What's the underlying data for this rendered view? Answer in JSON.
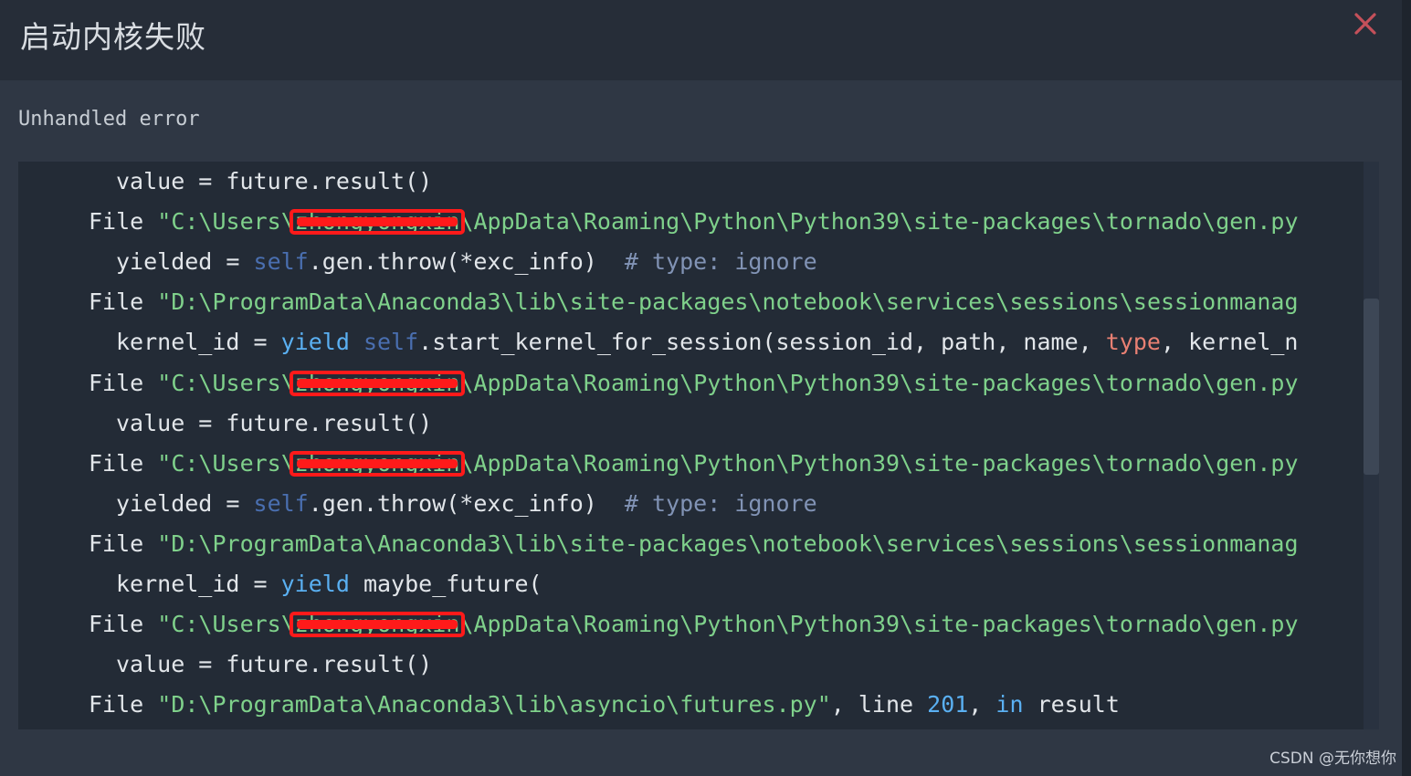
{
  "dialog": {
    "title": "启动内核失败",
    "close_icon": "close-icon",
    "error_label": "Unhandled error"
  },
  "colors": {
    "header_bg": "#262d38",
    "body_bg": "#2f3744",
    "trace_bg": "#232b36",
    "string": "#7fd18b",
    "keyword": "#5ab0f2",
    "self": "#4a6fb0",
    "builtin_type": "#e98073",
    "comment": "#8193b5",
    "redaction": "#ff1a1a",
    "close": "#c4505a"
  },
  "traceback": [
    {
      "tokens": [
        {
          "t": "value = future.result()"
        }
      ]
    },
    {
      "tokens": [
        {
          "t": "File "
        },
        {
          "t": "\"C:\\Users\\",
          "c": "str"
        },
        {
          "t": "zhongyongxin",
          "c": "str",
          "redacted": true
        },
        {
          "t": "\\AppData\\Roaming\\Python\\Python39\\site-packages\\tornado\\gen.py",
          "c": "str"
        }
      ]
    },
    {
      "tokens": [
        {
          "t": "yielded = "
        },
        {
          "t": "self",
          "c": "self"
        },
        {
          "t": ".gen.throw(*exc_info)  "
        },
        {
          "t": "# type: ignore",
          "c": "comment"
        }
      ]
    },
    {
      "tokens": [
        {
          "t": "File "
        },
        {
          "t": "\"D:\\ProgramData\\Anaconda3\\lib\\site-packages\\notebook\\services\\sessions\\sessionmanag",
          "c": "str"
        }
      ]
    },
    {
      "tokens": [
        {
          "t": "kernel_id = "
        },
        {
          "t": "yield",
          "c": "kw"
        },
        {
          "t": " "
        },
        {
          "t": "self",
          "c": "self"
        },
        {
          "t": ".start_kernel_for_session(session_id, path, name, "
        },
        {
          "t": "type",
          "c": "type"
        },
        {
          "t": ", kernel_n"
        }
      ]
    },
    {
      "tokens": [
        {
          "t": "File "
        },
        {
          "t": "\"C:\\Users\\",
          "c": "str"
        },
        {
          "t": "zhongyongxin",
          "c": "str",
          "redacted": true
        },
        {
          "t": "\\AppData\\Roaming\\Python\\Python39\\site-packages\\tornado\\gen.py",
          "c": "str"
        }
      ]
    },
    {
      "tokens": [
        {
          "t": "value = future.result()"
        }
      ]
    },
    {
      "tokens": [
        {
          "t": "File "
        },
        {
          "t": "\"C:\\Users\\",
          "c": "str"
        },
        {
          "t": "zhongyongxin",
          "c": "str",
          "redacted": true
        },
        {
          "t": "\\AppData\\Roaming\\Python\\Python39\\site-packages\\tornado\\gen.py",
          "c": "str"
        }
      ]
    },
    {
      "tokens": [
        {
          "t": "yielded = "
        },
        {
          "t": "self",
          "c": "self"
        },
        {
          "t": ".gen.throw(*exc_info)  "
        },
        {
          "t": "# type: ignore",
          "c": "comment"
        }
      ]
    },
    {
      "tokens": [
        {
          "t": "File "
        },
        {
          "t": "\"D:\\ProgramData\\Anaconda3\\lib\\site-packages\\notebook\\services\\sessions\\sessionmanag",
          "c": "str"
        }
      ]
    },
    {
      "tokens": [
        {
          "t": "kernel_id = "
        },
        {
          "t": "yield",
          "c": "kw"
        },
        {
          "t": " maybe_future("
        }
      ]
    },
    {
      "tokens": [
        {
          "t": "File "
        },
        {
          "t": "\"C:\\Users\\",
          "c": "str"
        },
        {
          "t": "zhongyongxin",
          "c": "str",
          "redacted": true
        },
        {
          "t": "\\AppData\\Roaming\\Python\\Python39\\site-packages\\tornado\\gen.py",
          "c": "str"
        }
      ]
    },
    {
      "tokens": [
        {
          "t": "value = future.result()"
        }
      ]
    },
    {
      "tokens": [
        {
          "t": "File "
        },
        {
          "t": "\"D:\\ProgramData\\Anaconda3\\lib\\asyncio\\futures.py\"",
          "c": "str"
        },
        {
          "t": ", line "
        },
        {
          "t": "201",
          "c": "num"
        },
        {
          "t": ", "
        },
        {
          "t": "in",
          "c": "kw"
        },
        {
          "t": " result"
        }
      ]
    }
  ],
  "watermark": "CSDN @无你想你"
}
